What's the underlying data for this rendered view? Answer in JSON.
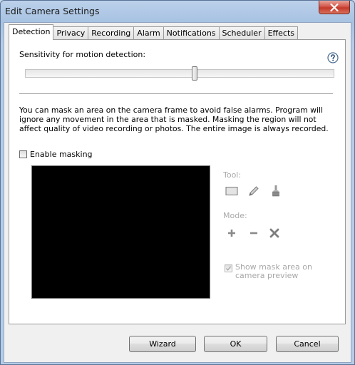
{
  "window": {
    "title": "Edit Camera Settings"
  },
  "tabs": [
    {
      "label": "Detection",
      "active": true
    },
    {
      "label": "Privacy"
    },
    {
      "label": "Recording"
    },
    {
      "label": "Alarm"
    },
    {
      "label": "Notifications"
    },
    {
      "label": "Scheduler"
    },
    {
      "label": "Effects"
    }
  ],
  "detection": {
    "sensitivity_label": "Sensitivity for motion detection:",
    "sensitivity_value": 0.55,
    "help_icon": "question-mark-circle-icon",
    "mask_description": "You can mask an area on the camera frame to avoid false alarms. Program will ignore any movement in the area that is masked.  Masking the region will not affect quality of video recording or photos. The entire image is always recorded.",
    "enable_masking_label": "Enable masking",
    "enable_masking_checked": false,
    "tool_label": "Tool:",
    "tools": [
      "rectangle-icon",
      "pencil-icon",
      "brush-icon"
    ],
    "mode_label": "Mode:",
    "modes": [
      "plus-icon",
      "minus-icon",
      "clear-x-icon"
    ],
    "show_mask_label": "Show mask area on camera preview",
    "show_mask_checked": true
  },
  "buttons": {
    "wizard": "Wizard",
    "ok": "OK",
    "cancel": "Cancel"
  }
}
